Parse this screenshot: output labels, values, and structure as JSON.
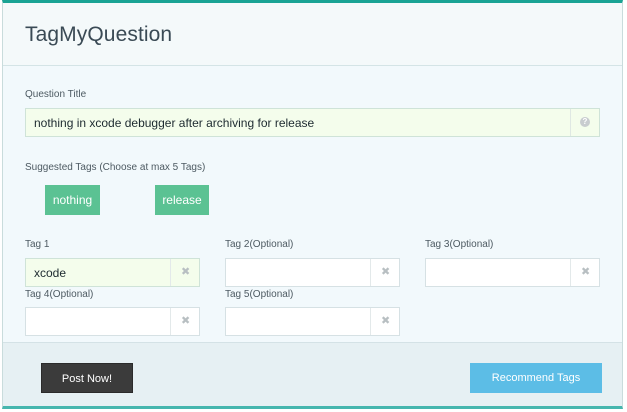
{
  "header": {
    "title": "TagMyQuestion"
  },
  "question": {
    "label": "Question Title",
    "value": "nothing in xcode debugger after archiving for release",
    "help_icon": "question-circle-icon"
  },
  "suggested": {
    "label": "Suggested Tags (Choose at max 5 Tags)",
    "tags": [
      "nothing",
      "release"
    ]
  },
  "tags": [
    {
      "label": "Tag 1",
      "value": "xcode"
    },
    {
      "label": "Tag 2(Optional)",
      "value": ""
    },
    {
      "label": "Tag 3(Optional)",
      "value": ""
    },
    {
      "label": "Tag 4(Optional)",
      "value": ""
    },
    {
      "label": "Tag 5(Optional)",
      "value": ""
    }
  ],
  "icons": {
    "clear": "close-icon",
    "clear_glyph": "✖",
    "help_glyph": "?"
  },
  "footer": {
    "post_label": "Post Now!",
    "recommend_label": "Recommend Tags"
  },
  "colors": {
    "accent_top": "#1aa394",
    "chip": "#5bc293",
    "post_button": "#3b3b3b",
    "recommend_button": "#5cbde6"
  }
}
